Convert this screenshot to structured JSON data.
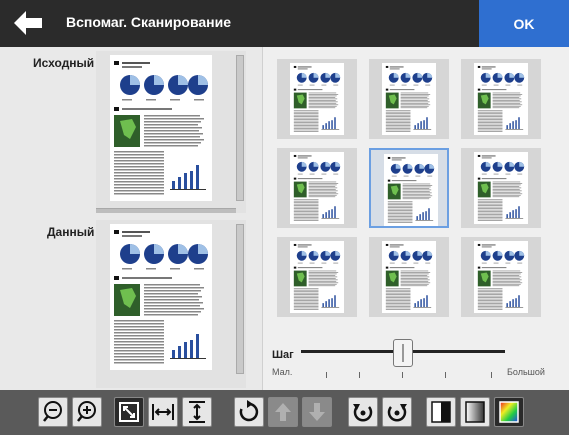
{
  "header": {
    "title": "Вспомаг. Сканирование",
    "ok_label": "OK"
  },
  "left": {
    "original_label": "Исходный",
    "given_label": "Данный"
  },
  "right": {
    "selected_index": 4,
    "step": {
      "label": "Шаг",
      "min_label": "Мал.",
      "max_label": "Большой",
      "position_fraction": 0.5
    }
  },
  "toolbar": {
    "items": [
      {
        "name": "zoom-out",
        "enabled": true
      },
      {
        "name": "zoom-in",
        "enabled": true
      },
      {
        "name": "fit-page",
        "enabled": true
      },
      {
        "name": "fit-width",
        "enabled": true
      },
      {
        "name": "fit-height",
        "enabled": true
      },
      {
        "name": "rotate",
        "enabled": true
      },
      {
        "name": "move-up",
        "enabled": false
      },
      {
        "name": "move-down",
        "enabled": false
      },
      {
        "name": "rotate-left",
        "enabled": true
      },
      {
        "name": "rotate-right",
        "enabled": true
      },
      {
        "name": "black-white",
        "enabled": true
      },
      {
        "name": "grayscale",
        "enabled": true
      },
      {
        "name": "color",
        "enabled": true
      }
    ]
  }
}
